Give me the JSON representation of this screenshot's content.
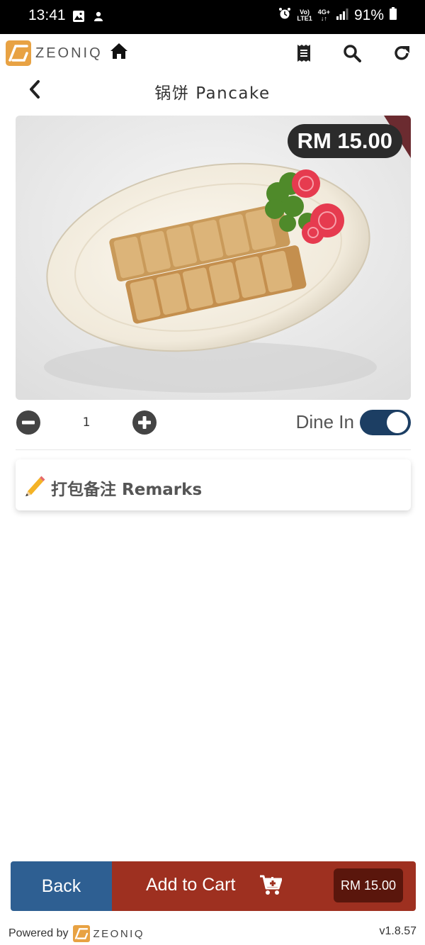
{
  "status_bar": {
    "time": "13:41",
    "network_top": "Vo)",
    "network_bottom": "LTE1",
    "net_type": "4G+",
    "battery": "91%"
  },
  "header": {
    "logo_text": "ZEONIQ",
    "icons": [
      "home-icon",
      "receipt-icon",
      "search-icon",
      "refresh-icon"
    ]
  },
  "page": {
    "title": "锅饼 Pancake"
  },
  "product": {
    "price": "RM 15.00"
  },
  "order": {
    "quantity": "1",
    "mode_label": "Dine In",
    "dine_in": true
  },
  "remarks": {
    "label": "打包备注 Remarks"
  },
  "actions": {
    "back_label": "Back",
    "add_to_cart_label": "Add to Cart",
    "total": "RM 15.00"
  },
  "footer": {
    "powered_by": "Powered by",
    "logo_text": "ZEONIQ",
    "version": "v1.8.57"
  },
  "colors": {
    "back_button": "#2e5f92",
    "cart_button": "#9e3020",
    "toggle_on": "#1c3e63",
    "brand": "#e8a243"
  }
}
